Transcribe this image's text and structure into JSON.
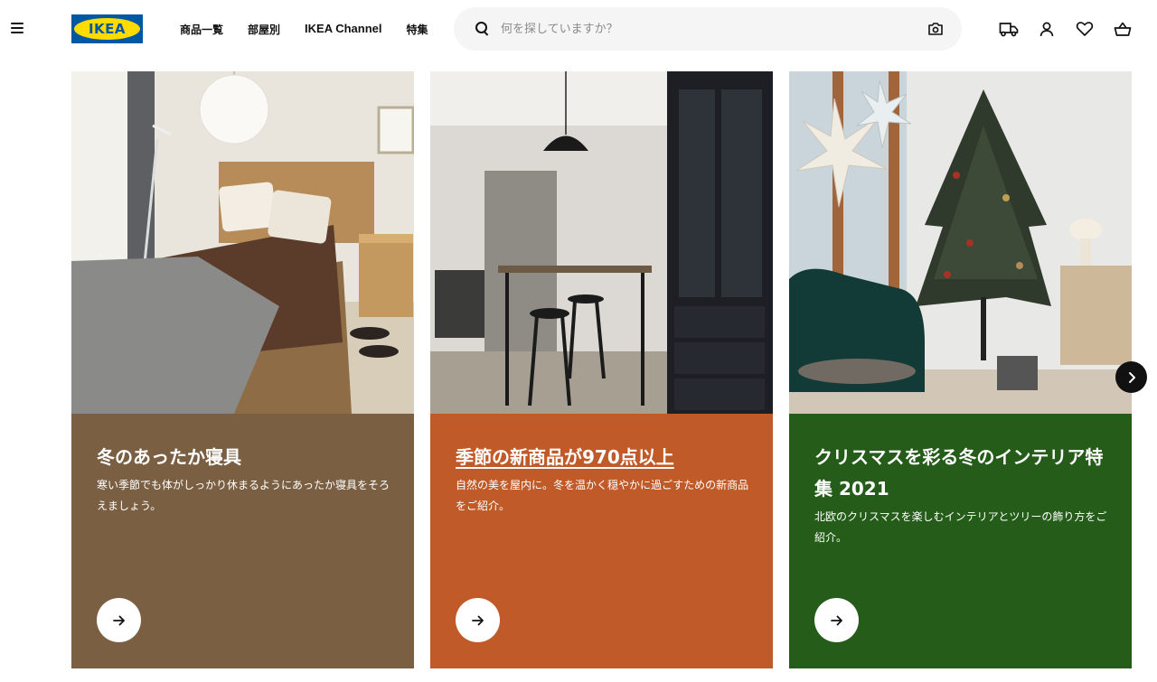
{
  "header": {
    "menu_icon": "hamburger-menu-icon",
    "logo_text": "IKEA",
    "brand_colors": {
      "blue": "#0058a3",
      "yellow": "#ffdb00"
    },
    "nav": [
      {
        "label": "商品一覧"
      },
      {
        "label": "部屋別"
      },
      {
        "label": "IKEA Channel"
      },
      {
        "label": "特集"
      }
    ],
    "search": {
      "placeholder": "何を探していますか？",
      "search_icon": "search-icon",
      "camera_icon": "camera-search-icon"
    },
    "actions": [
      {
        "icon": "delivery-truck-icon"
      },
      {
        "icon": "user-account-icon"
      },
      {
        "icon": "heart-favorites-icon"
      },
      {
        "icon": "shopping-basket-icon"
      }
    ]
  },
  "cards": [
    {
      "title": "冬のあったか寝具",
      "description": "寒い季節でも体がしっかり休まるようにあったか寝具をそろえましょう。",
      "panel_color": "#7a5f42",
      "arrow_icon": "arrow-right-icon"
    },
    {
      "title": "季節の新商品が970点以上",
      "description": "自然の美を屋内に。冬を温かく穏やかに過ごすための新商品をご紹介。",
      "panel_color": "#c05a28",
      "arrow_icon": "arrow-right-icon"
    },
    {
      "title": "クリスマスを彩る冬のインテリア特集 2021",
      "description": "北欧のクリスマスを楽しむインテリアとツリーの飾り方をご紹介。",
      "panel_color": "#255c1a",
      "arrow_icon": "arrow-right-icon"
    }
  ],
  "carousel": {
    "next_icon": "chevron-right-icon"
  }
}
